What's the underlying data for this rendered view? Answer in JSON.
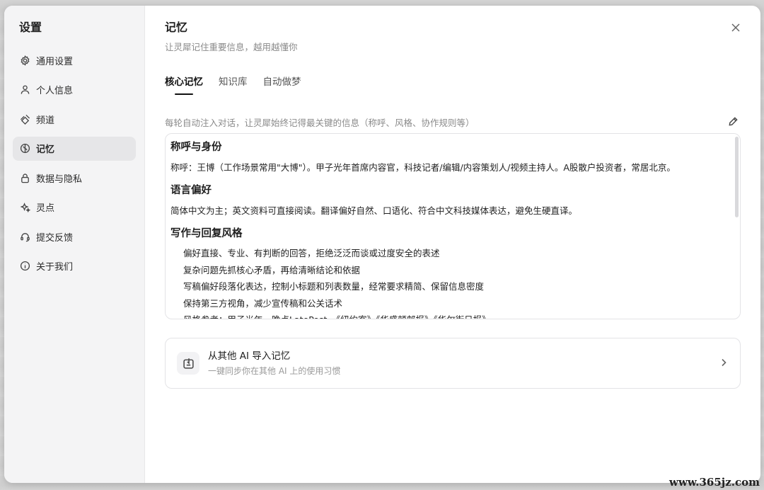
{
  "sidebar": {
    "title": "设置",
    "items": [
      {
        "label": "通用设置",
        "icon": "gear-icon"
      },
      {
        "label": "个人信息",
        "icon": "user-icon"
      },
      {
        "label": "频道",
        "icon": "channel-icon"
      },
      {
        "label": "记忆",
        "icon": "memory-icon",
        "active": true
      },
      {
        "label": "数据与隐私",
        "icon": "lock-icon"
      },
      {
        "label": "灵点",
        "icon": "sparkle-icon"
      },
      {
        "label": "提交反馈",
        "icon": "headset-icon"
      },
      {
        "label": "关于我们",
        "icon": "info-icon"
      }
    ]
  },
  "main": {
    "title": "记忆",
    "subtitle": "让灵犀记住重要信息，越用越懂你",
    "tabs": [
      {
        "label": "核心记忆",
        "active": true
      },
      {
        "label": "知识库"
      },
      {
        "label": "自动做梦"
      }
    ],
    "description": "每轮自动注入对话，让灵犀始终记得最关键的信息（称呼、风格、协作规则等）",
    "memory": {
      "identity_title": "称呼与身份",
      "identity_body": "称呼：王博（工作场景常用\"大博\"）。甲子光年首席内容官，科技记者/编辑/内容策划人/视频主持人。A股散户投资者，常居北京。",
      "language_title": "语言偏好",
      "language_body": "简体中文为主；英文资料可直接阅读。翻译偏好自然、口语化、符合中文科技媒体表达，避免生硬直译。",
      "style_title": "写作与回复风格",
      "style_items": [
        "偏好直接、专业、有判断的回答，拒绝泛泛而谈或过度安全的表述",
        "复杂问题先抓核心矛盾，再给清晰结论和依据",
        "写稿偏好段落化表达，控制小标题和列表数量，经常要求精简、保留信息密度",
        "保持第三方视角，减少宣传稿和公关话术",
        "风格参考：甲子光年、晚点LatePost、《纽约客》《华盛顿邮报》《华尔街日报》"
      ]
    },
    "import_card": {
      "title": "从其他 AI 导入记忆",
      "subtitle": "一键同步你在其他 AI 上的使用习惯"
    }
  },
  "watermark": "www.365jz.com"
}
